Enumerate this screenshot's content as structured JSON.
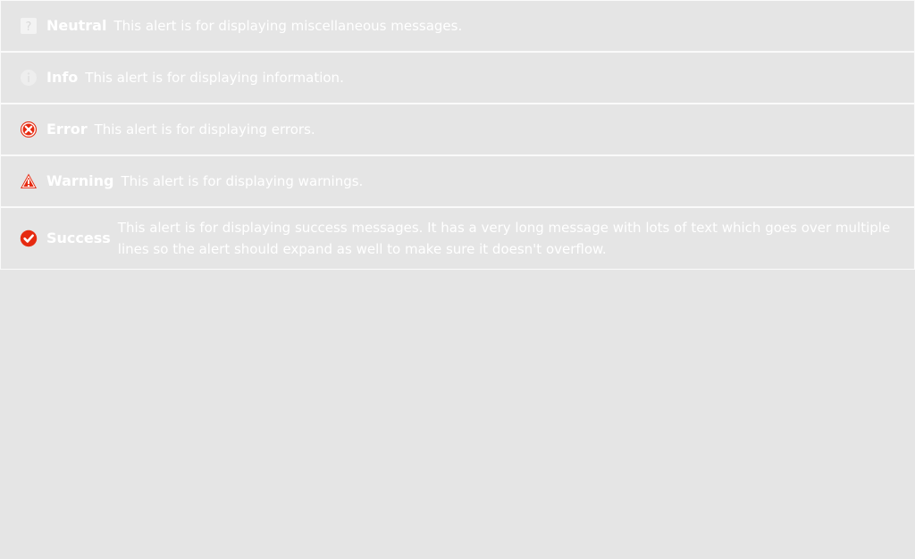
{
  "alerts": [
    {
      "type": "neutral",
      "icon": "question-icon",
      "title": "Neutral",
      "message": "This alert is for displaying miscellaneous messages."
    },
    {
      "type": "info",
      "icon": "info-icon",
      "title": "Info",
      "message": "This alert is for displaying information."
    },
    {
      "type": "error",
      "icon": "error-x-icon",
      "title": "Error",
      "message": "This alert is for displaying errors."
    },
    {
      "type": "warning",
      "icon": "warning-triangle-icon",
      "title": "Warning",
      "message": "This alert is for displaying warnings."
    },
    {
      "type": "success",
      "icon": "checkmark-icon",
      "title": "Success",
      "message": "This alert is for displaying success messages. It has a very long message with lots of text which goes over multiple lines so the alert should expand as well to make sure it doesn't overflow."
    }
  ],
  "colors": {
    "background": "#e5e5e5",
    "border": "#fafafa",
    "text": "#ffffff",
    "error": "#e62a10",
    "warning": "#e62a10",
    "success": "#e62a10",
    "neutral_icon": "#f3f3f3",
    "info_icon": "#eeeeee"
  }
}
